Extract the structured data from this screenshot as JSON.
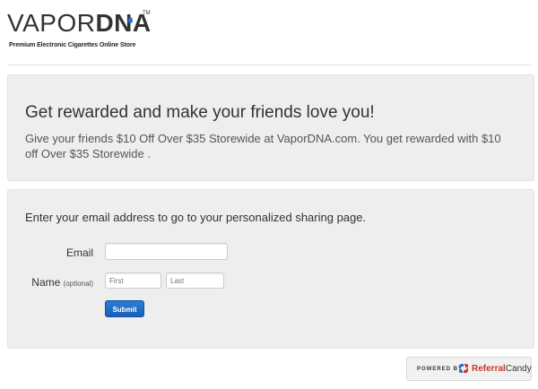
{
  "logo": {
    "name_thin": "VAPOR",
    "name_bold": "DNA",
    "trademark": "TM",
    "tagline": "Premium Electronic Cigarettes Online Store"
  },
  "hero": {
    "title": "Get rewarded and make your friends love you!",
    "text": "Give your friends $10 Off Over $35 Storewide at VaporDNA.com. You get rewarded with $10 off Over $35 Storewide ."
  },
  "form": {
    "prompt": "Enter your email address to go to your personalized sharing page.",
    "email_label": "Email",
    "email_value": "",
    "name_label": "Name",
    "name_hint": "(optional)",
    "first_placeholder": "First",
    "last_placeholder": "Last",
    "submit_label": "Submit"
  },
  "footer": {
    "powered_by": "POWERED BY",
    "brand_a": "Referral",
    "brand_b": "Candy"
  },
  "colors": {
    "accent": "#1a5fb7",
    "panel_bg": "#eeeeee",
    "brand_red": "#c23b2c"
  }
}
